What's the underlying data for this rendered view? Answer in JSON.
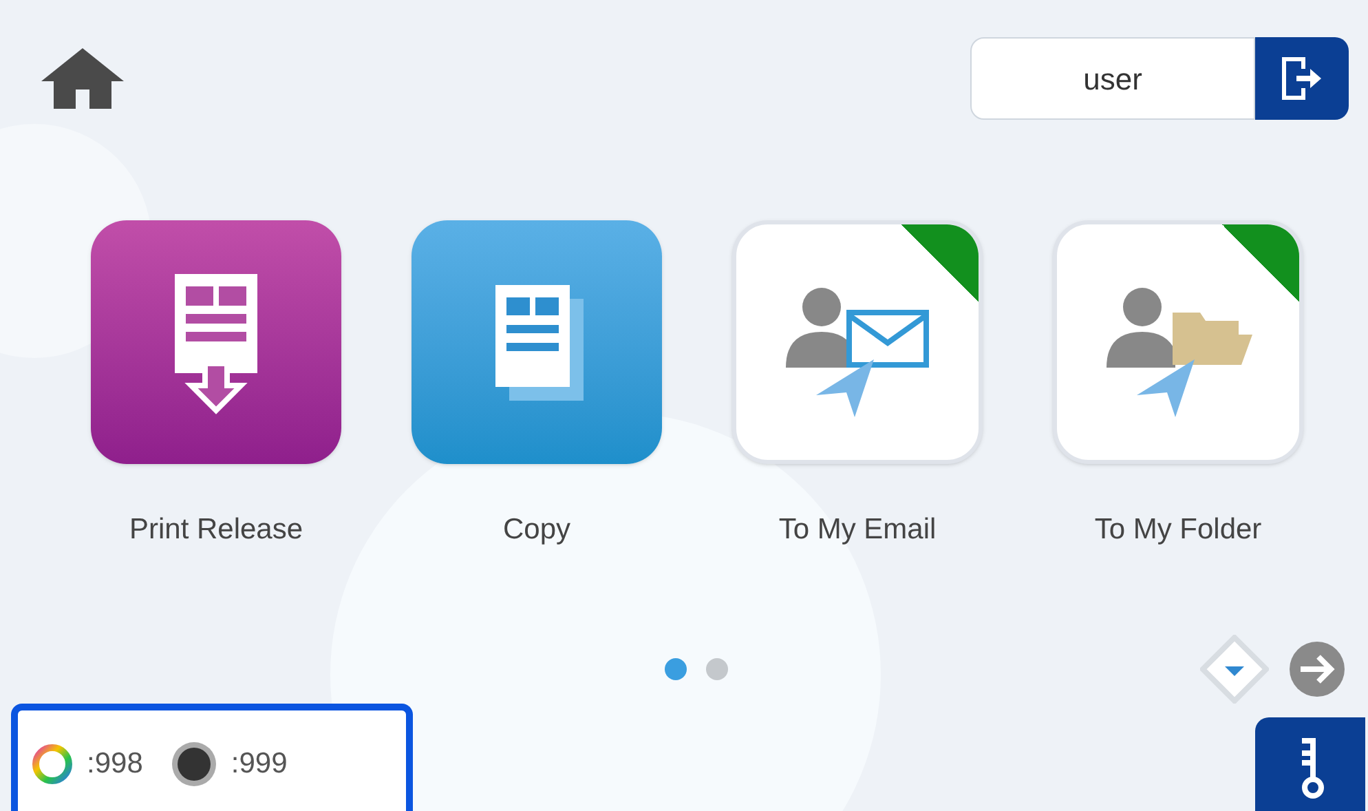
{
  "user": {
    "name": "user"
  },
  "apps": [
    {
      "label": "Print Release",
      "kind": "print-release",
      "corner_mark": false
    },
    {
      "label": "Copy",
      "kind": "copy",
      "corner_mark": false
    },
    {
      "label": "To My Email",
      "kind": "email",
      "corner_mark": true
    },
    {
      "label": "To My Folder",
      "kind": "folder",
      "corner_mark": true
    }
  ],
  "pages": [
    {
      "selected": true
    },
    {
      "selected": false
    }
  ],
  "counters": [
    {
      "kind": "color",
      "value": ":998"
    },
    {
      "kind": "black",
      "value": ":999"
    }
  ]
}
